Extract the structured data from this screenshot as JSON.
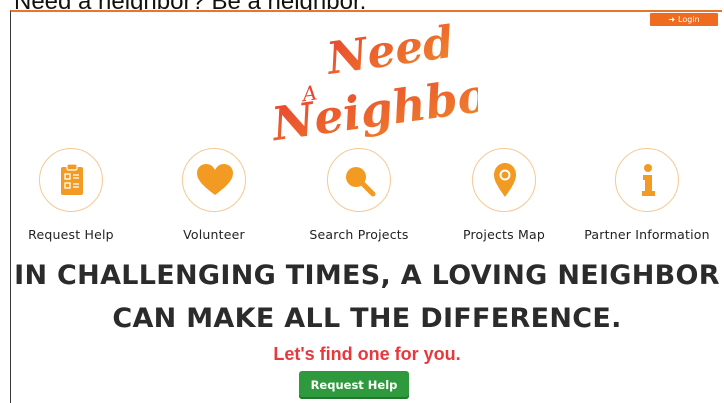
{
  "window": {
    "title": "Need a neighbor? Be a neighbor."
  },
  "header": {
    "login_label": "Login",
    "logo": {
      "line1": "Need",
      "line2": "A",
      "line3": "Neighbor"
    }
  },
  "nav": {
    "items": [
      {
        "label": "Request Help",
        "icon": "clipboard-icon"
      },
      {
        "label": "Volunteer",
        "icon": "heart-icon"
      },
      {
        "label": "Search Projects",
        "icon": "magnifier-icon"
      },
      {
        "label": "Projects Map",
        "icon": "map-pin-icon"
      },
      {
        "label": "Partner Information",
        "icon": "info-icon"
      }
    ]
  },
  "hero": {
    "headline_line1": "IN CHALLENGING TIMES, A LOVING NEIGHBOR",
    "headline_line2": "CAN MAKE ALL THE DIFFERENCE.",
    "tagline": "Let's find one for you.",
    "cta_label": "Request Help"
  },
  "colors": {
    "brand_orange": "#f29a21",
    "logo_red": "#e9432f",
    "login_orange": "#ee6b1f",
    "cta_green": "#2f9a3d",
    "tagline_red": "#e8383b"
  }
}
